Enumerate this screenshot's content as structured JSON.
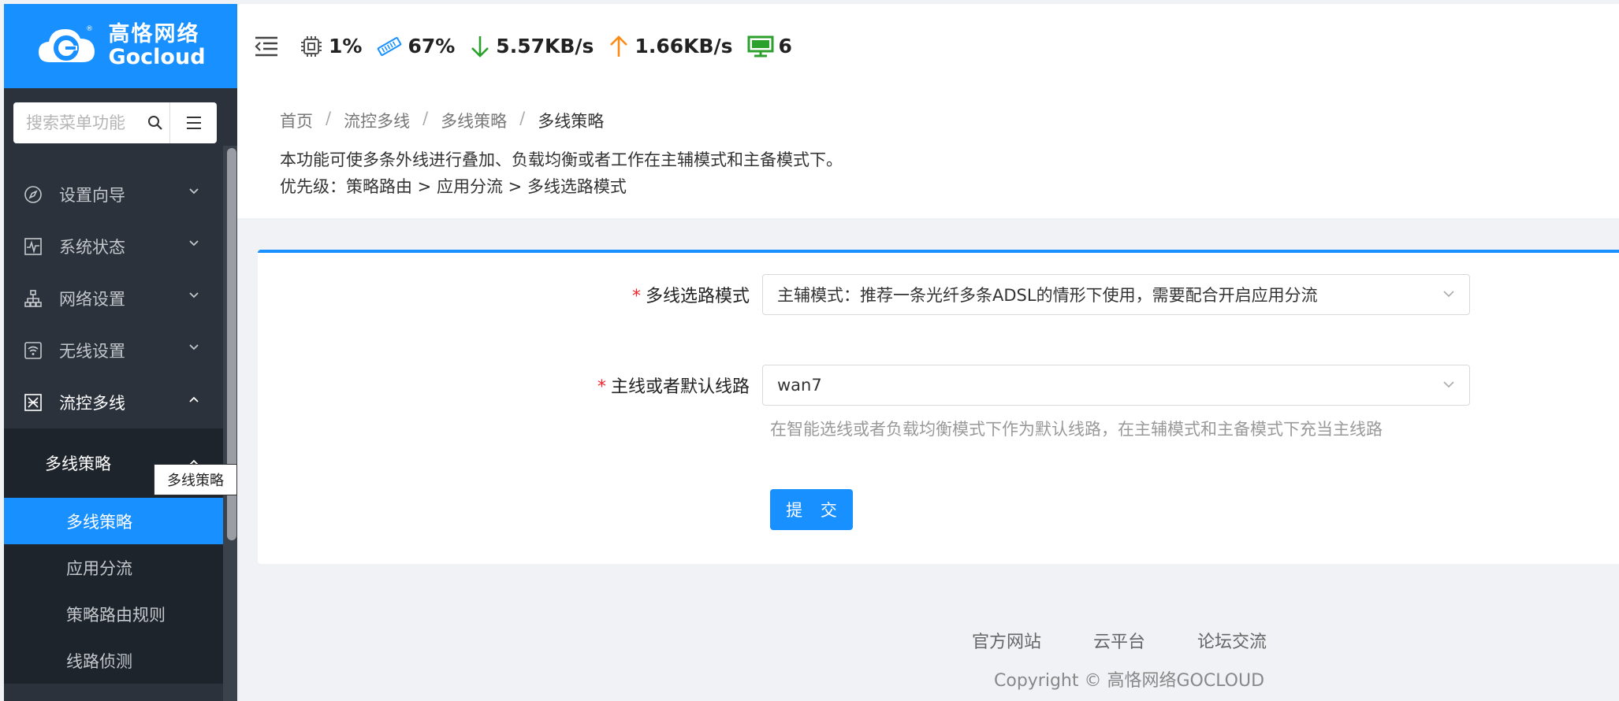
{
  "brand": {
    "name_cn": "高恪网络",
    "name_en": "Gocloud",
    "accent": "#1890ff"
  },
  "sidebar": {
    "search_placeholder": "搜索菜单功能",
    "items": [
      {
        "label": "设置向导",
        "icon": "compass-icon"
      },
      {
        "label": "系统状态",
        "icon": "pulse-icon"
      },
      {
        "label": "网络设置",
        "icon": "network-icon"
      },
      {
        "label": "无线设置",
        "icon": "wifi-icon"
      },
      {
        "label": "流控多线",
        "icon": "flow-control-icon"
      }
    ],
    "submenu": {
      "label": "多线策略",
      "items": [
        "多线策略",
        "应用分流",
        "策略路由规则",
        "线路侦测"
      ],
      "active": "多线策略"
    },
    "tooltip": "多线策略"
  },
  "topbar": {
    "cpu": "1%",
    "memory": "67%",
    "download": "5.57KB/s",
    "upload": "1.66KB/s",
    "devices": "6"
  },
  "breadcrumb": [
    "首页",
    "流控多线",
    "多线策略",
    "多线策略"
  ],
  "description": {
    "line1": "本功能可使多条外线进行叠加、负载均衡或者工作在主辅模式和主备模式下。",
    "line2": "优先级：策略路由 > 应用分流 > 多线选路模式"
  },
  "form": {
    "mode_label": "多线选路模式",
    "mode_value": "主辅模式：推荐一条光纤多条ADSL的情形下使用，需要配合开启应用分流",
    "line_label": "主线或者默认线路",
    "line_value": "wan7",
    "line_hint": "在智能选线或者负载均衡模式下作为默认线路，在主辅模式和主备模式下充当主线路",
    "submit_label": "提 交"
  },
  "footer": {
    "links": [
      "官方网站",
      "云平台",
      "论坛交流"
    ],
    "copyright": "Copyright © 高恪网络GOCLOUD"
  }
}
